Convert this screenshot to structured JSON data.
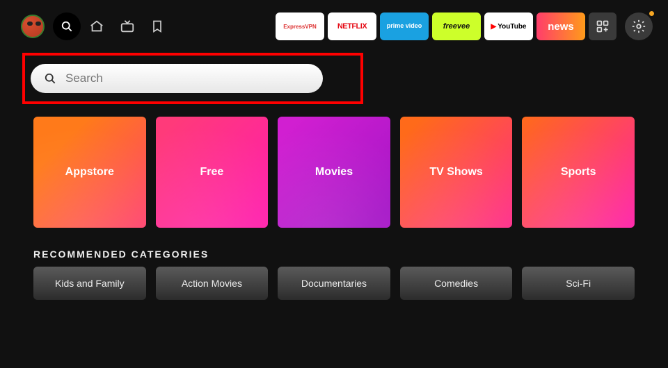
{
  "topApps": [
    {
      "key": "express",
      "label": "ExpressVPN"
    },
    {
      "key": "netflix",
      "label": "NETFLIX"
    },
    {
      "key": "prime",
      "label": "prime video"
    },
    {
      "key": "freevee",
      "label": "freevee"
    },
    {
      "key": "youtube",
      "label": "YouTube"
    },
    {
      "key": "news",
      "label": "news"
    }
  ],
  "search": {
    "placeholder": "Search"
  },
  "hero": [
    {
      "key": "appstore",
      "label": "Appstore"
    },
    {
      "key": "free",
      "label": "Free"
    },
    {
      "key": "movies",
      "label": "Movies"
    },
    {
      "key": "tvshows",
      "label": "TV Shows"
    },
    {
      "key": "sports",
      "label": "Sports"
    }
  ],
  "recommended": {
    "title": "RECOMMENDED CATEGORIES",
    "items": [
      "Kids and Family",
      "Action Movies",
      "Documentaries",
      "Comedies",
      "Sci-Fi"
    ]
  }
}
